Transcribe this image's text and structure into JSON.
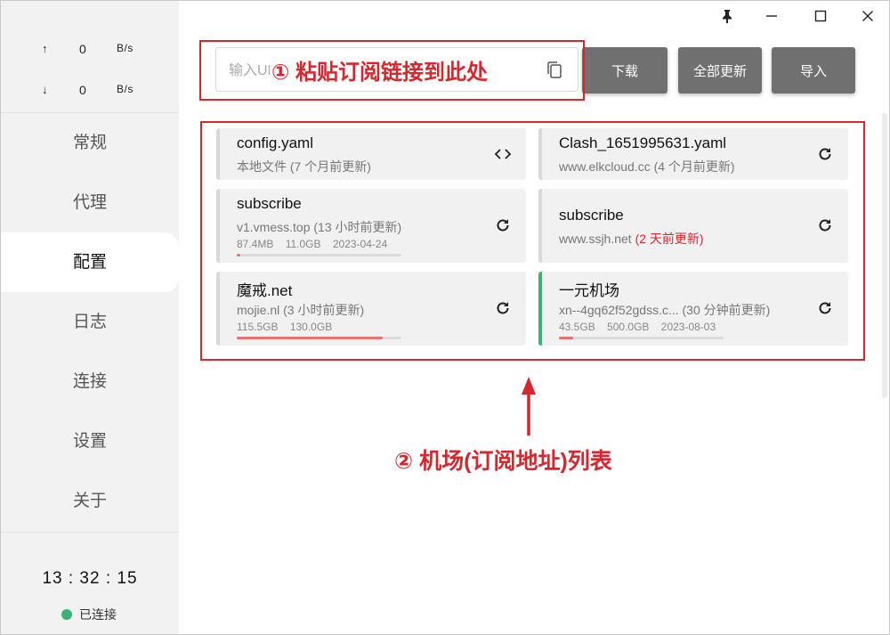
{
  "window": {
    "pin_icon": "pin-icon",
    "minimize_icon": "minimize-icon",
    "maximize_icon": "maximize-icon",
    "close_icon": "close-icon"
  },
  "traffic": {
    "up": {
      "arrow": "↑",
      "value": "0",
      "unit": "B/s"
    },
    "down": {
      "arrow": "↓",
      "value": "0",
      "unit": "B/s"
    }
  },
  "nav": {
    "items": [
      {
        "label": "常规"
      },
      {
        "label": "代理"
      },
      {
        "label": "配置"
      },
      {
        "label": "日志"
      },
      {
        "label": "连接"
      },
      {
        "label": "设置"
      },
      {
        "label": "关于"
      }
    ],
    "active_index": 2
  },
  "status": {
    "clock": "13 : 32 : 15",
    "connection": "已连接",
    "connection_color": "#3cb371"
  },
  "toolbar": {
    "input_placeholder": "输入URL",
    "download_label": "下载",
    "update_all_label": "全部更新",
    "import_label": "导入"
  },
  "annotations": {
    "paste_hint": "① 粘贴订阅链接到此处",
    "list_hint": "② 机场(订阅地址)列表",
    "color": "#d7262e"
  },
  "profiles": [
    {
      "name": "config.yaml",
      "sub": "本地文件 (7 个月前更新)",
      "sub_red": "",
      "stats": [],
      "usage_fraction": null,
      "action_icon": "code-icon",
      "active": false
    },
    {
      "name": "Clash_1651995631.yaml",
      "sub": "www.elkcloud.cc (4 个月前更新)",
      "sub_red": "",
      "stats": [],
      "usage_fraction": null,
      "action_icon": "refresh-icon",
      "active": false
    },
    {
      "name": "subscribe",
      "sub": "v1.vmess.top (13 小时前更新)",
      "sub_red": "",
      "stats": [
        "87.4MB",
        "11.0GB",
        "2023-04-24"
      ],
      "usage_fraction": 0.008,
      "action_icon": "refresh-icon",
      "active": false
    },
    {
      "name": "subscribe",
      "sub": "www.ssjh.net ",
      "sub_red": "(2 天前更新)",
      "stats": [],
      "usage_fraction": null,
      "action_icon": "refresh-icon",
      "active": false
    },
    {
      "name": "魔戒.net",
      "sub": "mojie.nl (3 小时前更新)",
      "sub_red": "",
      "stats": [
        "115.5GB",
        "130.0GB"
      ],
      "usage_fraction": 0.888,
      "action_icon": "refresh-icon",
      "active": false
    },
    {
      "name": "一元机场",
      "sub": "xn--4gq62f52gdss.c... (30 分钟前更新)",
      "sub_red": "",
      "stats": [
        "43.5GB",
        "500.0GB",
        "2023-08-03"
      ],
      "usage_fraction": 0.087,
      "action_icon": "refresh-icon",
      "active": true
    }
  ]
}
